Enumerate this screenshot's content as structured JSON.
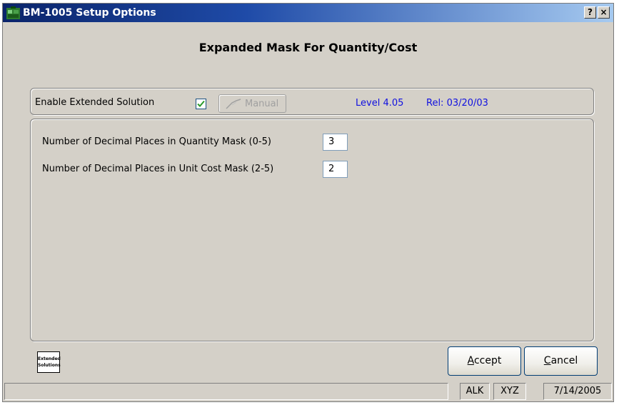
{
  "window": {
    "title": "BM-1005 Setup Options",
    "help_button": "?",
    "close_button": "×"
  },
  "heading": "Expanded Mask For Quantity/Cost",
  "top_panel": {
    "enable_label": "Enable Extended Solution",
    "enable_checked": true,
    "manual_button": "Manual",
    "level": "Level 4.05",
    "release": "Rel: 03/20/03"
  },
  "fields": [
    {
      "label": "Number of Decimal Places in Quantity Mask (0-5)",
      "value": "3"
    },
    {
      "label": "Number of Decimal Places in Unit Cost Mask (2-5)",
      "value": "2"
    }
  ],
  "logo": {
    "line1": "Extended",
    "line2": "Solutions"
  },
  "buttons": {
    "accept": "Accept",
    "cancel": "Cancel"
  },
  "statusbar": {
    "message": "",
    "company": "ALK",
    "user": "XYZ",
    "date": "7/14/2005"
  },
  "colors": {
    "title_bar": "#0a246a",
    "link_blue": "#1010e0",
    "window_bg": "#d4d0c8",
    "check_green": "#2a9a2a"
  }
}
